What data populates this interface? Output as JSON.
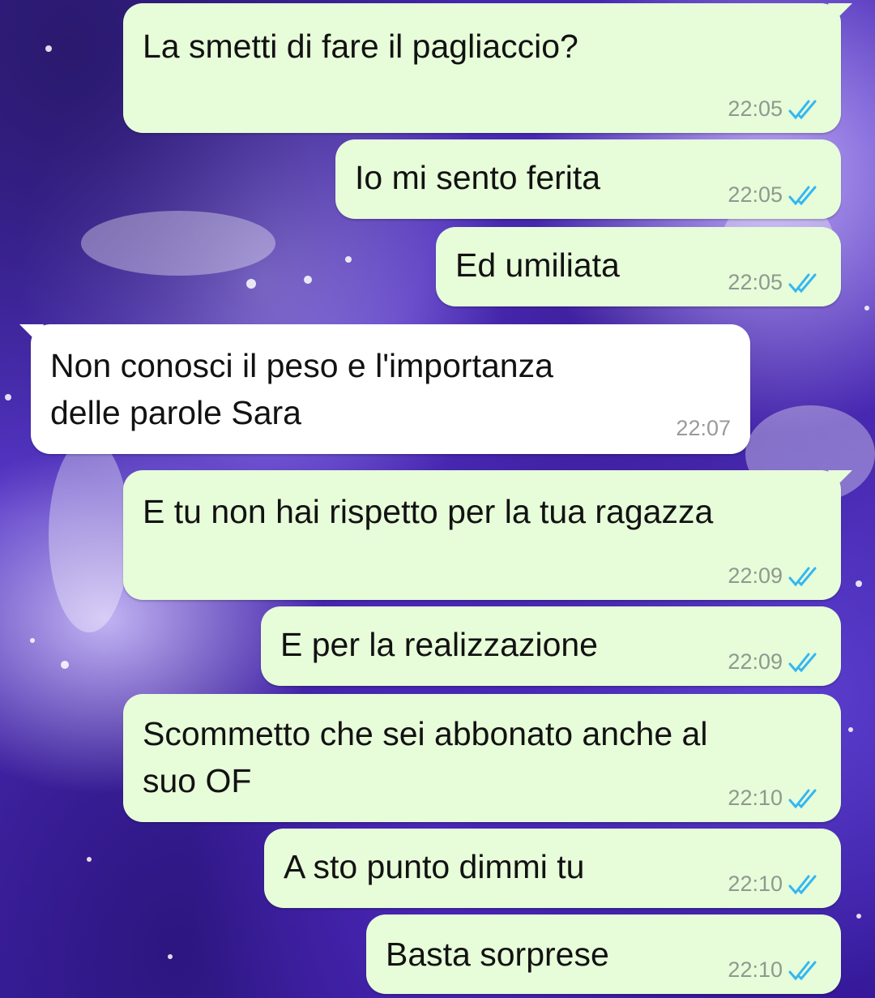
{
  "wallpaper": {
    "colors": [
      "#3a1f9c",
      "#5535c8",
      "#b9a6f2"
    ],
    "description_icon": "sparkle-wallpaper"
  },
  "messages": [
    {
      "direction": "outgoing",
      "text": "La smetti di fare il pagliaccio?",
      "time": "22:05",
      "status": "read-double-check-icon"
    },
    {
      "direction": "outgoing",
      "text": "Io mi sento ferita",
      "time": "22:05",
      "status": "read-double-check-icon"
    },
    {
      "direction": "outgoing",
      "text": "Ed umiliata",
      "time": "22:05",
      "status": "read-double-check-icon"
    },
    {
      "direction": "incoming",
      "text": "Non conosci il peso e l'importanza\ndelle parole Sara",
      "time": "22:07"
    },
    {
      "direction": "outgoing",
      "text": "E tu non hai rispetto per la tua ragazza",
      "time": "22:09",
      "status": "read-double-check-icon"
    },
    {
      "direction": "outgoing",
      "text": "E per la realizzazione",
      "time": "22:09",
      "status": "read-double-check-icon"
    },
    {
      "direction": "outgoing",
      "text": "Scommetto che sei abbonato anche al\nsuo OF",
      "time": "22:10",
      "status": "read-double-check-icon"
    },
    {
      "direction": "outgoing",
      "text": "A sto punto dimmi tu",
      "time": "22:10",
      "status": "read-double-check-icon"
    },
    {
      "direction": "outgoing",
      "text": "Basta sorprese",
      "time": "22:10",
      "status": "read-double-check-icon"
    }
  ],
  "colors": {
    "outgoing_bubble": "#e7fcd9",
    "incoming_bubble": "#ffffff",
    "read_ticks": "#34b7f1",
    "timestamp": "#8d9a8e"
  }
}
